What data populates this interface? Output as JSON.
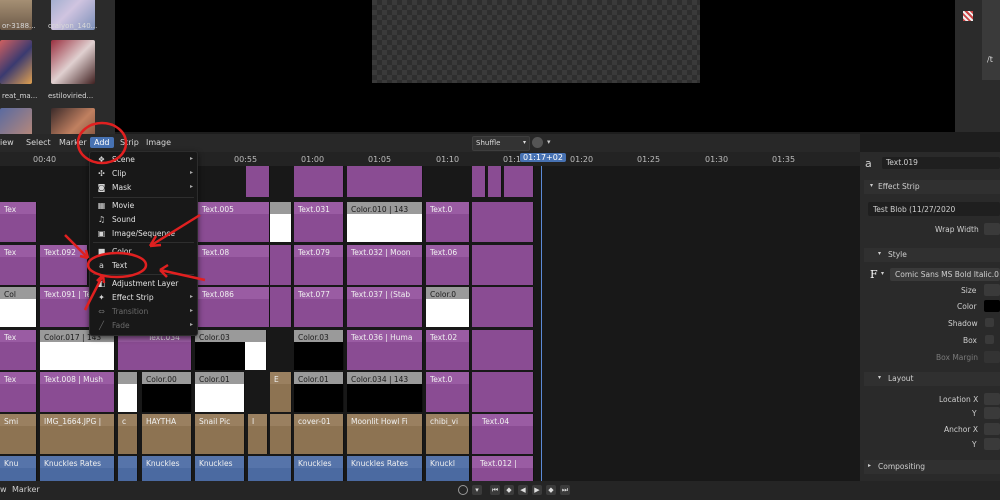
{
  "file_browser": {
    "items": [
      {
        "label": "or-3188..."
      },
      {
        "label": "craiyon_140..."
      },
      {
        "label": "reat_ma..."
      },
      {
        "label": "estiloviried..."
      }
    ]
  },
  "header": {
    "menus": [
      "View",
      "Select",
      "Marker",
      "Add",
      "Strip",
      "Image"
    ],
    "view_label": "iew",
    "active_menu": "Add",
    "shuffle_label": "Shuffle"
  },
  "ruler": {
    "ticks": [
      "00:40",
      "00:55",
      "01:00",
      "01:05",
      "01:10",
      "01:1",
      "01:20",
      "01:25",
      "01:30",
      "01:35"
    ],
    "playhead": "01:17+02"
  },
  "add_menu": {
    "items": [
      {
        "label": "Scene",
        "icon": "scene-icon",
        "submenu": true,
        "enabled": true
      },
      {
        "label": "Clip",
        "icon": "clip-icon",
        "submenu": true,
        "enabled": true
      },
      {
        "label": "Mask",
        "icon": "mask-icon",
        "submenu": true,
        "enabled": true
      },
      {
        "label": "Movie",
        "icon": "movie-icon",
        "submenu": false,
        "enabled": true
      },
      {
        "label": "Sound",
        "icon": "sound-icon",
        "submenu": false,
        "enabled": true
      },
      {
        "label": "Image/Sequence",
        "icon": "image-icon",
        "submenu": false,
        "enabled": true
      },
      {
        "label": "Color",
        "icon": "color-icon",
        "submenu": false,
        "enabled": true
      },
      {
        "label": "Text",
        "icon": "text-icon",
        "submenu": false,
        "enabled": true
      },
      {
        "label": "Adjustment Layer",
        "icon": "adjustment-icon",
        "submenu": false,
        "enabled": true
      },
      {
        "label": "Effect Strip",
        "icon": "effect-icon",
        "submenu": true,
        "enabled": true
      },
      {
        "label": "Transition",
        "icon": "transition-icon",
        "submenu": true,
        "enabled": false
      },
      {
        "label": "Fade",
        "icon": "fade-icon",
        "submenu": true,
        "enabled": false
      }
    ]
  },
  "strips": {
    "r1": [
      "Tex",
      "Text.005",
      "Text.031",
      "Color.010 | 143",
      "Text.0"
    ],
    "r2": [
      "Tex",
      "Text.092",
      "Text.08",
      "Text.079",
      "Text.032 | Moon",
      "Text.06"
    ],
    "r3": [
      "Col",
      "Text.091 | Tex",
      "Text.086",
      "Text.077",
      "Text.037 | (Stab",
      "Color.0"
    ],
    "r4": [
      "Tex",
      "Color.017 | 143",
      "Text.034",
      "Color.03",
      "Color.03",
      "Text.036 | Huma",
      "Text.02"
    ],
    "r5": [
      "Tex",
      "Text.008 | Mush",
      "Color.00",
      "Color.01",
      "E",
      "Color.01",
      "Color.034 | 143",
      "Text.0"
    ],
    "r6": [
      "Smi",
      "IMG_1664.JPG |",
      "c",
      "HAYTHA",
      "Snail Pic",
      "I",
      "cover-01",
      "Moonlit Howl Fi",
      "chibi_vi",
      "Text.04"
    ],
    "r7": [
      "Knu",
      "Knuckles Rates",
      "Knuckles",
      "Knuckles",
      "Knuckles",
      "Knuckles Rates",
      "Knuckl",
      "Text.012 |"
    ]
  },
  "sidebar": {
    "strip_name": "Text.019",
    "sections": {
      "effect_strip": "Effect Strip",
      "style": "Style",
      "layout": "Layout",
      "compositing": "Compositing"
    },
    "text_value": "Test Blob (11/27/2020",
    "wrap_width": "Wrap Width",
    "font_name": "Comic Sans MS Bold Italic.0",
    "style_props": [
      "Size",
      "Color",
      "Shadow",
      "Box",
      "Box Margin"
    ],
    "layout_props": [
      "Location X",
      "Y",
      "Anchor X",
      "Y"
    ]
  },
  "topright": {
    "label": "/t"
  },
  "bottom": {
    "left": "w",
    "marker": "Marker"
  }
}
